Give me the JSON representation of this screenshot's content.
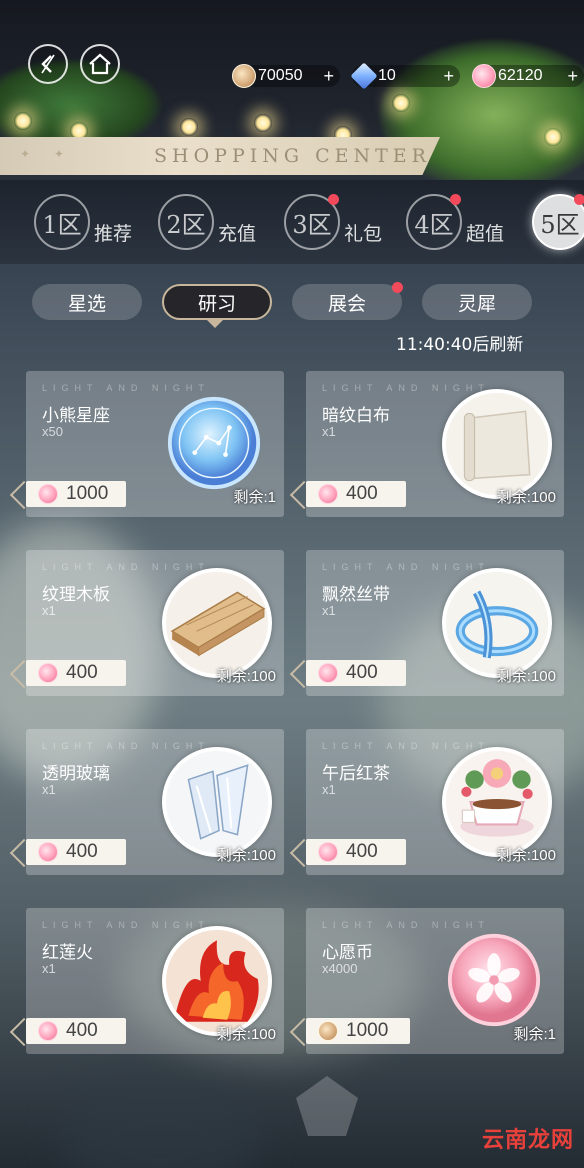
{
  "nav": {
    "back_icon": "back-arrow-icon",
    "home_icon": "home-icon"
  },
  "currencies": [
    {
      "icon": "coin-icon",
      "value": "70050",
      "plus": "+"
    },
    {
      "icon": "gem-icon",
      "value": "10",
      "plus": "+"
    },
    {
      "icon": "pink-token-icon",
      "value": "62120",
      "plus": "+"
    }
  ],
  "banner": {
    "title": "SHOPPING CENTER"
  },
  "zones": [
    {
      "num": "1区",
      "label": "推荐",
      "dot": false,
      "active": false
    },
    {
      "num": "2区",
      "label": "充值",
      "dot": false,
      "active": false
    },
    {
      "num": "3区",
      "label": "礼包",
      "dot": true,
      "active": false
    },
    {
      "num": "4区",
      "label": "超值",
      "dot": true,
      "active": false
    },
    {
      "num": "5区",
      "label": "",
      "dot": true,
      "active": true
    }
  ],
  "subtabs": [
    {
      "label": "星选",
      "active": false,
      "dot": false
    },
    {
      "label": "研习",
      "active": true,
      "dot": false
    },
    {
      "label": "展会",
      "active": false,
      "dot": true
    },
    {
      "label": "灵犀",
      "active": false,
      "dot": false
    }
  ],
  "refresh_text": "11:40:40后刷新",
  "card_watermark": "LIGHT AND NIGHT",
  "items": [
    {
      "name": "小熊星座",
      "qty": "x50",
      "price": "1000",
      "currency": "pink-token-icon",
      "remain": "剩余:1",
      "thumb": "constellation-coin"
    },
    {
      "name": "暗纹白布",
      "qty": "x1",
      "price": "400",
      "currency": "pink-token-icon",
      "remain": "剩余:100",
      "thumb": "white-cloth"
    },
    {
      "name": "纹理木板",
      "qty": "x1",
      "price": "400",
      "currency": "pink-token-icon",
      "remain": "剩余:100",
      "thumb": "wood-planks"
    },
    {
      "name": "飘然丝带",
      "qty": "x1",
      "price": "400",
      "currency": "pink-token-icon",
      "remain": "剩余:100",
      "thumb": "blue-ribbon"
    },
    {
      "name": "透明玻璃",
      "qty": "x1",
      "price": "400",
      "currency": "pink-token-icon",
      "remain": "剩余:100",
      "thumb": "glass-shards"
    },
    {
      "name": "午后红茶",
      "qty": "x1",
      "price": "400",
      "currency": "pink-token-icon",
      "remain": "剩余:100",
      "thumb": "tea-cup"
    },
    {
      "name": "红莲火",
      "qty": "x1",
      "price": "400",
      "currency": "pink-token-icon",
      "remain": "剩余:100",
      "thumb": "red-flame"
    },
    {
      "name": "心愿币",
      "qty": "x4000",
      "price": "1000",
      "currency": "coin-icon",
      "remain": "剩余:1",
      "thumb": "wish-coin"
    }
  ],
  "site_watermark": "云南龙网"
}
